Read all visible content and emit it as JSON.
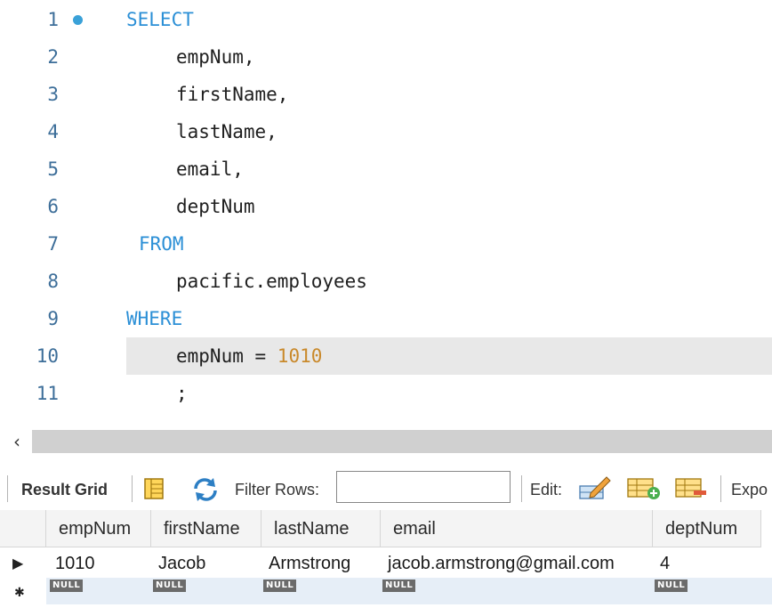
{
  "editor": {
    "lines": [
      {
        "num": "1",
        "parts": [
          {
            "t": "SELECT",
            "k": "kw"
          }
        ]
      },
      {
        "num": "2",
        "parts": [
          {
            "t": "empNum,"
          }
        ]
      },
      {
        "num": "3",
        "parts": [
          {
            "t": "firstName,"
          }
        ]
      },
      {
        "num": "4",
        "parts": [
          {
            "t": "lastName,"
          }
        ]
      },
      {
        "num": "5",
        "parts": [
          {
            "t": "email,"
          }
        ]
      },
      {
        "num": "6",
        "parts": [
          {
            "t": "deptNum"
          }
        ]
      },
      {
        "num": "7",
        "parts": [
          {
            "t": "FROM",
            "k": "kw"
          }
        ]
      },
      {
        "num": "8",
        "parts": [
          {
            "t": "pacific.employees"
          }
        ]
      },
      {
        "num": "9",
        "parts": [
          {
            "t": "WHERE",
            "k": "kw"
          }
        ]
      },
      {
        "num": "10",
        "parts": [
          {
            "t": "empNum = "
          },
          {
            "t": "1010",
            "k": "num"
          }
        ]
      },
      {
        "num": "11",
        "parts": [
          {
            "t": ";"
          }
        ]
      }
    ],
    "current_line": "10",
    "marker_line": "1"
  },
  "scroll": {
    "left_arrow": "‹"
  },
  "toolbar": {
    "result_grid_label": "Result Grid",
    "filter_label": "Filter Rows:",
    "filter_value": "",
    "edit_label": "Edit:",
    "export_label": "Expo"
  },
  "grid": {
    "columns": [
      "empNum",
      "firstName",
      "lastName",
      "email",
      "deptNum"
    ],
    "rows": [
      [
        "1010",
        "Jacob",
        "Armstrong",
        "jacob.armstrong@gmail.com",
        "4"
      ]
    ],
    "new_row_values": [
      "NULL",
      "NULL",
      "NULL",
      "NULL",
      "NULL"
    ],
    "current_row_marker": "▶",
    "new_row_marker": "✱"
  },
  "colors": {
    "keyword": "#2b8fd6",
    "number": "#c9892b",
    "line_number": "#3d6e99"
  }
}
